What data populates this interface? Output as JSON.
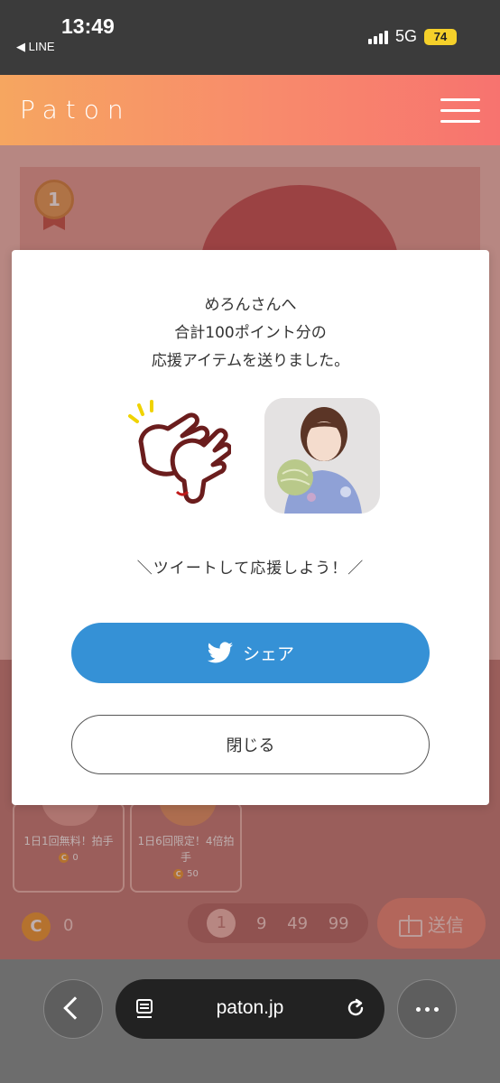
{
  "status_bar": {
    "time": "13:49",
    "back_app": "◀ LINE",
    "network": "5G",
    "battery": "74"
  },
  "header": {
    "logo": "Paton",
    "accent_gradient": [
      "#f6a660",
      "#f7736f"
    ]
  },
  "background": {
    "rank": "1",
    "items": [
      {
        "name": "1日1回無料！拍手",
        "cost": "0",
        "coin_symbol": "C"
      },
      {
        "name": "1日6回限定！4倍拍手",
        "cost": "50",
        "coin_symbol": "C"
      }
    ],
    "coin_symbol": "C",
    "coin_balance": "0",
    "quantity_options": [
      "1",
      "9",
      "49",
      "99"
    ],
    "selected_quantity": "1",
    "send_label": "送信"
  },
  "modal": {
    "message_line1": "めろんさんへ",
    "message_line2": "合計100ポイント分の",
    "message_line3": "応援アイテムを送りました。",
    "tweet_prompt": "＼ツイートして応援しよう！／",
    "share_label": "シェア",
    "close_label": "閉じる",
    "share_color": "#3591d6"
  },
  "browser": {
    "url": "paton.jp",
    "icons": [
      "chevron-left-icon",
      "page-icon",
      "reload-icon",
      "more-icon"
    ]
  }
}
